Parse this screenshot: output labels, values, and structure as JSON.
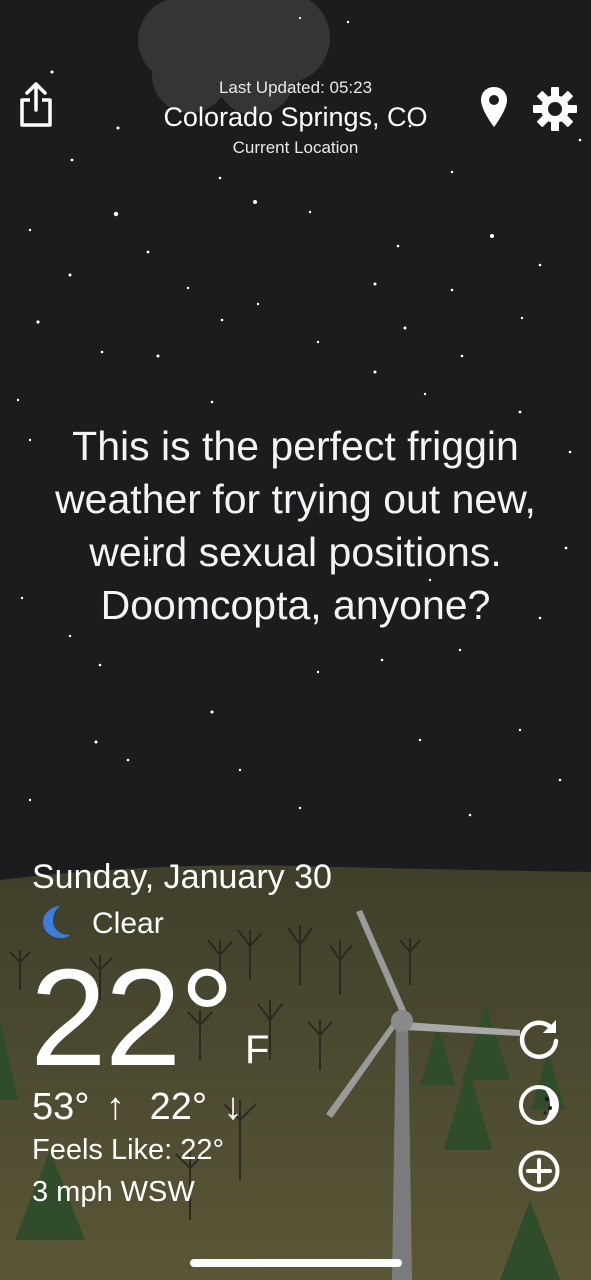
{
  "header": {
    "last_updated": "Last Updated: 05:23",
    "location_name": "Colorado Springs, CO",
    "location_sub": "Current Location",
    "share_icon": "share-icon",
    "location_icon": "map-pin-icon",
    "settings_icon": "gear-icon"
  },
  "message": "This is the perfect friggin weather for trying out new, weird sexual positions. Doomcopta, anyone?",
  "weather": {
    "date": "Sunday, January 30",
    "condition_icon": "crescent-moon-icon",
    "condition": "Clear",
    "temperature": "22°",
    "unit": "F",
    "high": "53°",
    "low": "22°",
    "high_arrow": "↑",
    "low_arrow": "↓",
    "feels_like": "Feels Like: 22°",
    "wind": "3 mph WSW"
  },
  "actions": {
    "refresh_icon": "refresh-icon",
    "moon_phase_icon": "moon-phase-icon",
    "add_icon": "add-circle-icon"
  },
  "colors": {
    "sky": "#1c1c1e",
    "hill": "#4a4a2e",
    "tree": "#2f4d2a",
    "moon_icon": "#3a7fe0"
  }
}
